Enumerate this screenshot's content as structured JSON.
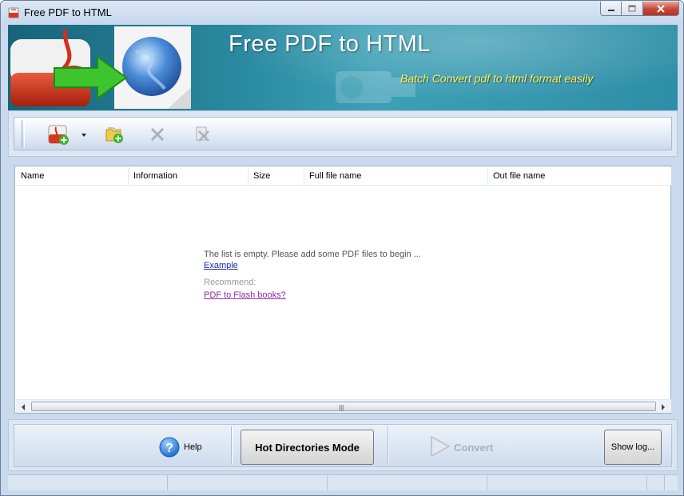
{
  "window": {
    "title": "Free PDF to HTML"
  },
  "banner": {
    "title": "Free PDF to HTML",
    "subtitle": "Batch Convert  pdf to html format easily"
  },
  "toolbar": {
    "buttons": [
      {
        "name": "add-pdf-button",
        "icon": "add-pdf-icon"
      },
      {
        "name": "add-folder-button",
        "icon": "add-folder-icon"
      },
      {
        "name": "remove-button",
        "icon": "delete-x-icon"
      },
      {
        "name": "clear-button",
        "icon": "clear-icon"
      }
    ]
  },
  "list": {
    "columns": [
      "Name",
      "Information",
      "Size",
      "Full file name",
      "Out file name"
    ],
    "empty_message": "The list is empty. Please add some PDF files to begin ...",
    "example_link": "Example",
    "recommend_label": "Recommend:",
    "recommend_link": "PDF to Flash books?"
  },
  "bottom": {
    "help_label": "Help",
    "hot_directories_label": "Hot Directories Mode",
    "convert_label": "Convert",
    "show_log_label": "Show log..."
  },
  "status": {
    "cells": [
      "",
      "",
      "",
      "",
      "",
      ""
    ]
  },
  "colors": {
    "banner_bg": "#2a8aa1",
    "banner_subtitle": "#fff25a",
    "link_example": "#1a2ea8",
    "link_recommend": "#8a2fa6",
    "window_bg": "#c9daee"
  }
}
